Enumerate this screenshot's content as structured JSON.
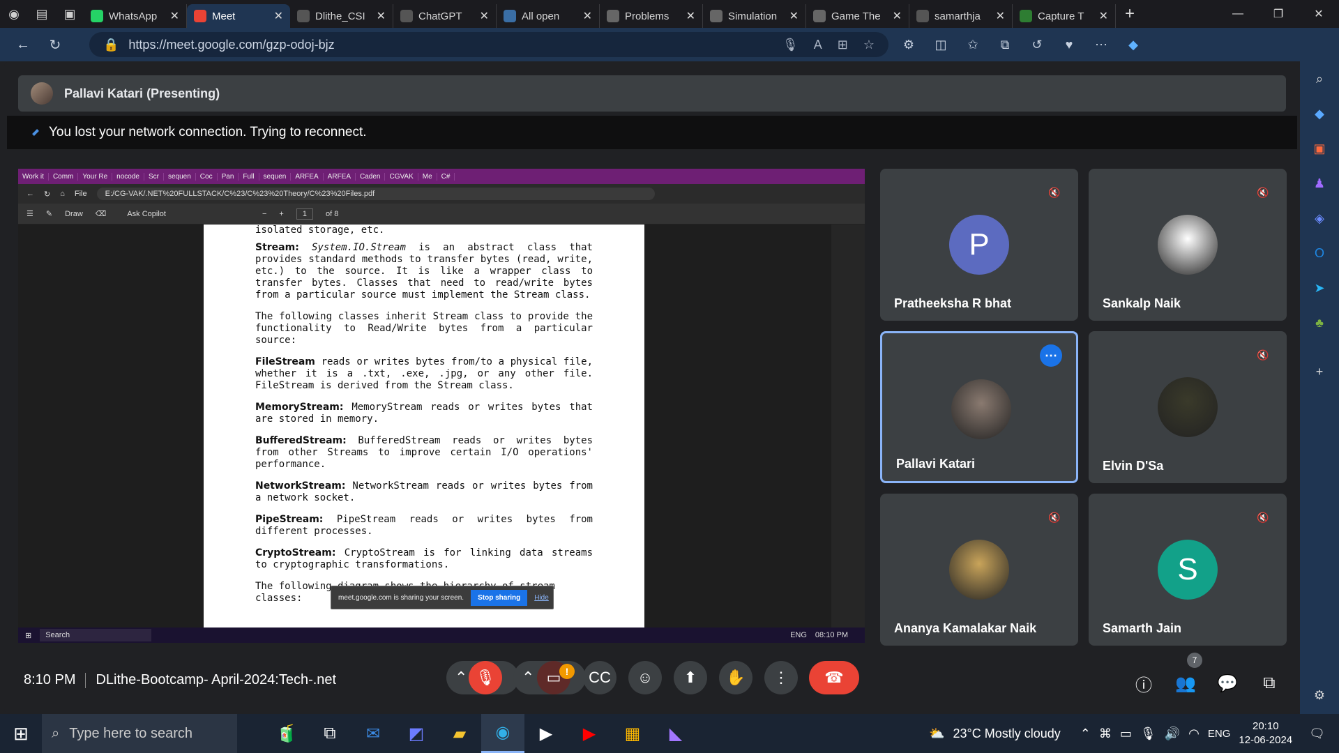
{
  "browser_tabs": [
    {
      "title": "WhatsApp",
      "icon": "whatsapp-icon",
      "color": "#25d366",
      "active": false
    },
    {
      "title": "Meet",
      "icon": "meet-icon",
      "color": "#ea4335",
      "active": true
    },
    {
      "title": "Dlithe_CSI",
      "icon": "github-icon",
      "color": "#555",
      "active": false
    },
    {
      "title": "ChatGPT",
      "icon": "chatgpt-icon",
      "color": "#555",
      "active": false
    },
    {
      "title": "All open",
      "icon": "link-icon",
      "color": "#3a6ea5",
      "active": false
    },
    {
      "title": "Problems",
      "icon": "code-icon",
      "color": "#666",
      "active": false
    },
    {
      "title": "Simulation",
      "icon": "code-icon",
      "color": "#666",
      "active": false
    },
    {
      "title": "Game The",
      "icon": "code-icon",
      "color": "#666",
      "active": false
    },
    {
      "title": "samarthja",
      "icon": "github-icon",
      "color": "#555",
      "active": false
    },
    {
      "title": "Capture T",
      "icon": "capture-icon",
      "color": "#2e7d32",
      "active": false
    }
  ],
  "address": {
    "url": "https://meet.google.com/gzp-odoj-bjz"
  },
  "presenting": {
    "label": "Pallavi Katari (Presenting)"
  },
  "network": {
    "message": "You lost your network connection. Trying to reconnect."
  },
  "shared_screen": {
    "tabs": [
      "Work it",
      "Comm",
      "Your Re",
      "nocode",
      "Scr",
      "sequen",
      "Coc",
      "Pan",
      "Full",
      "sequen",
      "ARFEA",
      "ARFEA",
      "Caden",
      "CGVAK",
      "Me",
      "C#"
    ],
    "file_label": "File",
    "url": "E:/CG-VAK/.NET%20FULLSTACK/C%23/C%23%20Theory/C%23%20Files.pdf",
    "toolbar": {
      "draw": "Draw",
      "copilot": "Ask Copilot",
      "page": "1",
      "of": "of 8"
    },
    "content": {
      "top_line": "isolated storage, etc.",
      "stream_head": "Stream:",
      "stream_class": "System.IO.Stream",
      "stream_body": "is an abstract class that provides standard methods to transfer bytes (read, write, etc.) to the source. It is like a wrapper class to transfer bytes. Classes that need to read/write bytes from a particular source must implement the Stream class.",
      "inherit": "The following classes inherit Stream class to provide the functionality to Read/Write bytes from a particular source:",
      "fs_head": "FileStream",
      "fs_body": "reads or writes bytes from/to a physical file, whether it is a .txt, .exe, .jpg, or any other file. FileStream is derived from the Stream class.",
      "ms_head": "MemoryStream:",
      "ms_body": "MemoryStream reads or writes bytes that are stored in memory.",
      "bs_head": "BufferedStream:",
      "bs_body": "BufferedStream reads or writes bytes from other Streams to improve certain I/O operations' performance.",
      "ns_head": "NetworkStream:",
      "ns_body": "NetworkStream reads or writes bytes from a network socket.",
      "ps_head": "PipeStream:",
      "ps_body": "PipeStream reads or writes bytes from different processes.",
      "cs_head": "CryptoStream:",
      "cs_body": "CryptoStream is for linking data streams to cryptographic transformations.",
      "diagram": "The following diagram shows the hierarchy of stream classes:"
    },
    "notice": {
      "text": "meet.google.com is sharing your screen.",
      "stop": "Stop sharing",
      "hide": "Hide"
    },
    "taskbar": {
      "search": "Search",
      "lang": "ENG",
      "time": "08:10 PM"
    }
  },
  "participants": [
    {
      "name": "Pratheeksha R bhat",
      "initial": "P",
      "color": "#5c6bc0",
      "muted": true,
      "active": false,
      "photo": false
    },
    {
      "name": "Sankalp Naik",
      "initial": "",
      "color": "#ffffff",
      "muted": true,
      "active": false,
      "photo": true
    },
    {
      "name": "Pallavi Katari",
      "initial": "",
      "color": "#8a7a70",
      "muted": false,
      "active": true,
      "photo": true
    },
    {
      "name": "Elvin D'Sa",
      "initial": "",
      "color": "#3a3a2a",
      "muted": true,
      "active": false,
      "photo": true
    },
    {
      "name": "Ananya Kamalakar Naik",
      "initial": "",
      "color": "#c9a45a",
      "muted": true,
      "active": false,
      "photo": true
    },
    {
      "name": "Samarth Jain",
      "initial": "S",
      "color": "#12a189",
      "muted": true,
      "active": false,
      "photo": false
    }
  ],
  "meeting": {
    "time": "8:10 PM",
    "title": "DLithe-Bootcamp- April-2024:Tech-.net",
    "people_count": "7"
  },
  "taskbar": {
    "search_placeholder": "Type here to search",
    "weather": "23°C  Mostly cloudy",
    "lang": "ENG",
    "time": "20:10",
    "date": "12-06-2024"
  },
  "colors": {
    "meet_bg": "#202124",
    "tile": "#3c4043",
    "end_call": "#ea4335",
    "accent": "#1a73e8"
  }
}
